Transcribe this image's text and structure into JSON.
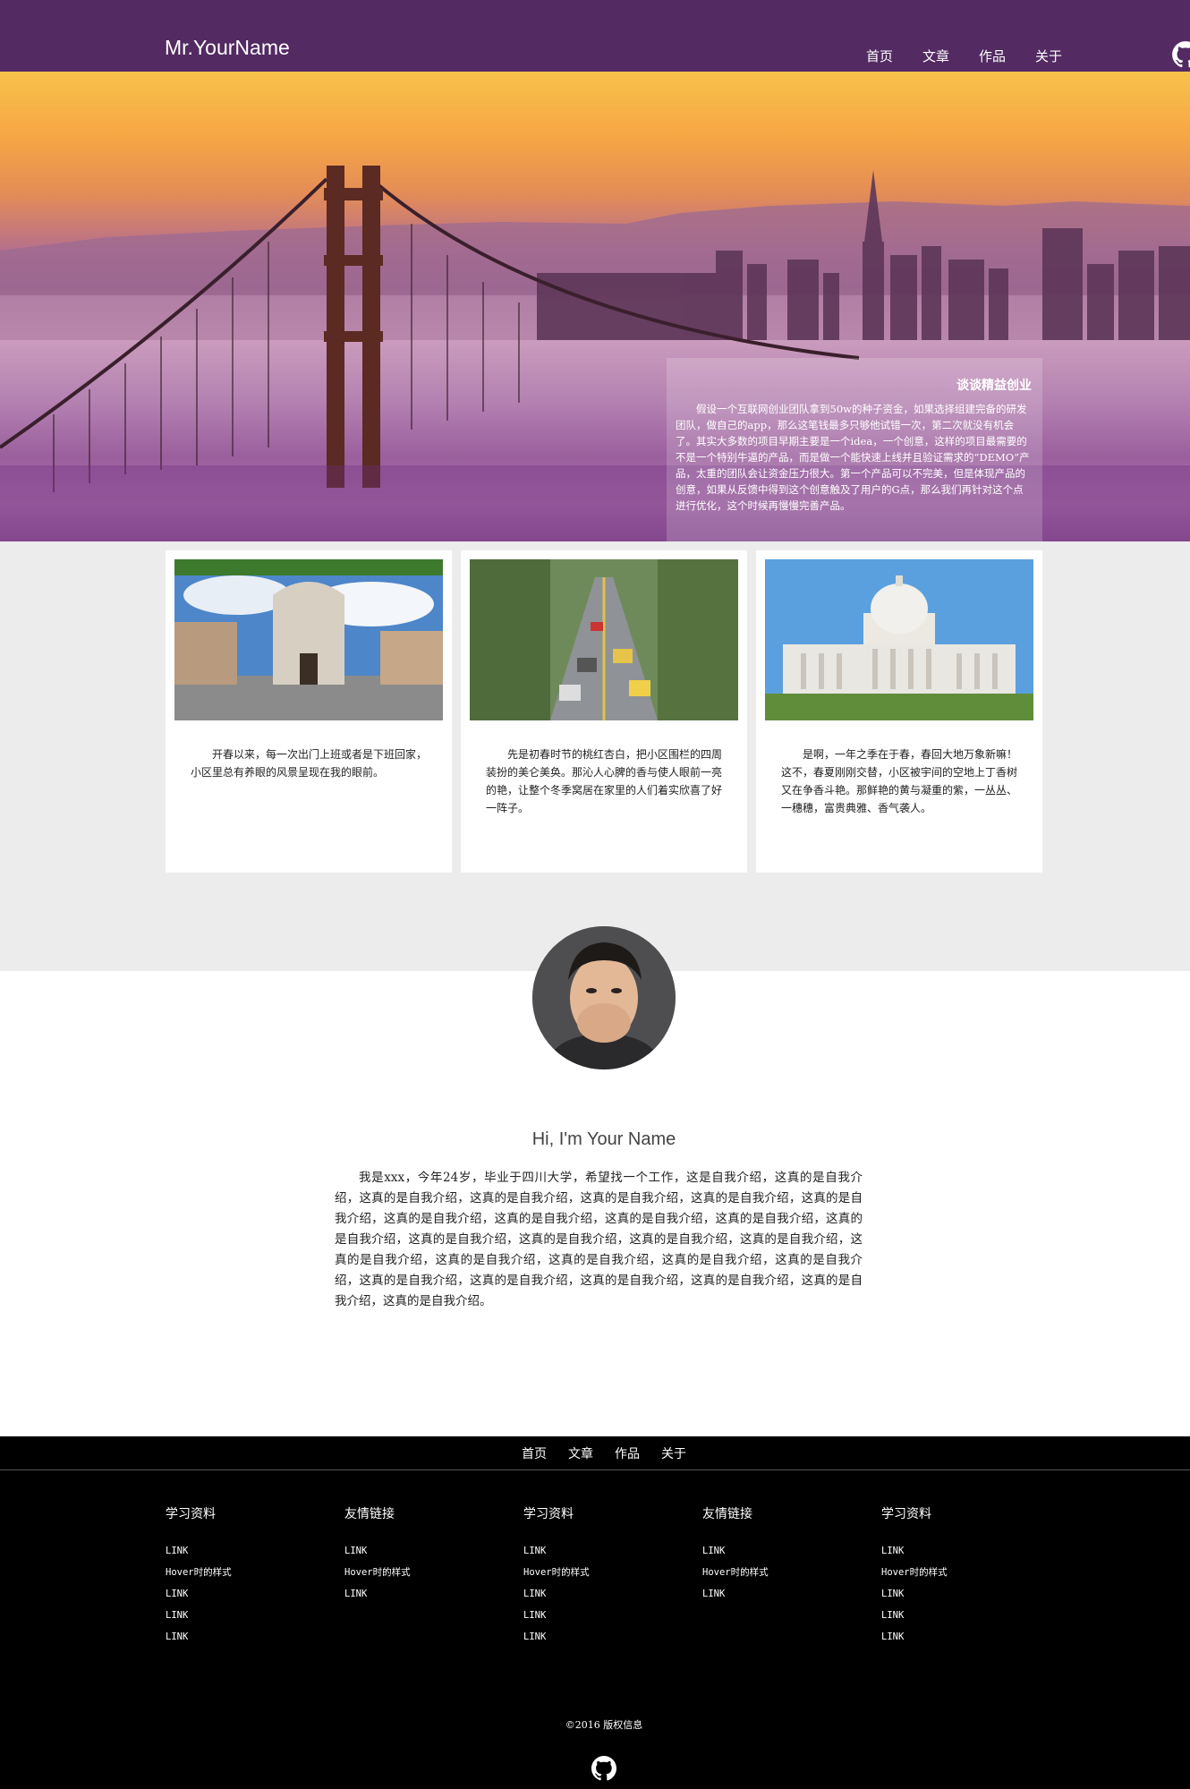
{
  "header": {
    "brand": "Mr.YourName",
    "nav": [
      "首页",
      "文章",
      "作品",
      "关于"
    ],
    "github_icon": "github-octocat-icon"
  },
  "hero": {
    "card_title": "谈谈精益创业",
    "card_text": "假设一个互联网创业团队拿到50w的种子资金，如果选择组建完备的研发团队，做自己的app，那么这笔钱最多只够他试错一次，第二次就没有机会了。其实大多数的项目早期主要是一个idea，一个创意，这样的项目最需要的不是一个特别牛逼的产品，而是做一个能快速上线并且验证需求的“DEMO”产品，太重的团队会让资金压力很大。第一个产品可以不完美，但是体现产品的创意，如果从反馈中得到这个创意触及了用户的G点，那么我们再针对这个点进行优化，这个时候再慢慢完善产品。"
  },
  "cards": [
    {
      "text": "开春以来，每一次出门上班或者是下班回家，小区里总有养眼的风景呈现在我的眼前。"
    },
    {
      "text": "先是初春时节的桃红杏白，把小区围栏的四周装扮的美仑美奂。那沁人心脾的香与使人眼前一亮的艳，让整个冬季窝居在家里的人们着实欣喜了好一阵子。"
    },
    {
      "text": "是啊，一年之季在于春，春回大地万象新嘛！这不，春夏刚刚交替，小区被宇间的空地上丁香树又在争香斗艳。那鲜艳的黄与凝重的紫，一丛丛、一穗穗，富贵典雅、香气袭人。"
    }
  ],
  "about": {
    "title": "Hi, I'm Your Name",
    "text": "我是xxx，今年24岁，毕业于四川大学，希望找一个工作，这是自我介绍，这真的是自我介绍，这真的是自我介绍，这真的是自我介绍，这真的是自我介绍，这真的是自我介绍，这真的是自我介绍，这真的是自我介绍，这真的是自我介绍，这真的是自我介绍，这真的是自我介绍，这真的是自我介绍，这真的是自我介绍，这真的是自我介绍，这真的是自我介绍，这真的是自我介绍，这真的是自我介绍，这真的是自我介绍，这真的是自我介绍，这真的是自我介绍，这真的是自我介绍，这真的是自我介绍，这真的是自我介绍，这真的是自我介绍，这真的是自我介绍，这真的是自我介绍，这真的是自我介绍。"
  },
  "footer": {
    "nav": [
      "首页",
      "文章",
      "作品",
      "关于"
    ],
    "columns": [
      {
        "title": "学习资料",
        "links": [
          "LINK",
          "Hover时的样式",
          "LINK",
          "LINK",
          "LINK"
        ]
      },
      {
        "title": "友情链接",
        "links": [
          "LINK",
          "Hover时的样式",
          "LINK"
        ]
      },
      {
        "title": "学习资料",
        "links": [
          "LINK",
          "Hover时的样式",
          "LINK",
          "LINK",
          "LINK"
        ]
      },
      {
        "title": "友情链接",
        "links": [
          "LINK",
          "Hover时的样式",
          "LINK"
        ]
      },
      {
        "title": "学习资料",
        "links": [
          "LINK",
          "Hover时的样式",
          "LINK",
          "LINK",
          "LINK"
        ]
      }
    ],
    "copyright": "©2016 版权信息"
  }
}
